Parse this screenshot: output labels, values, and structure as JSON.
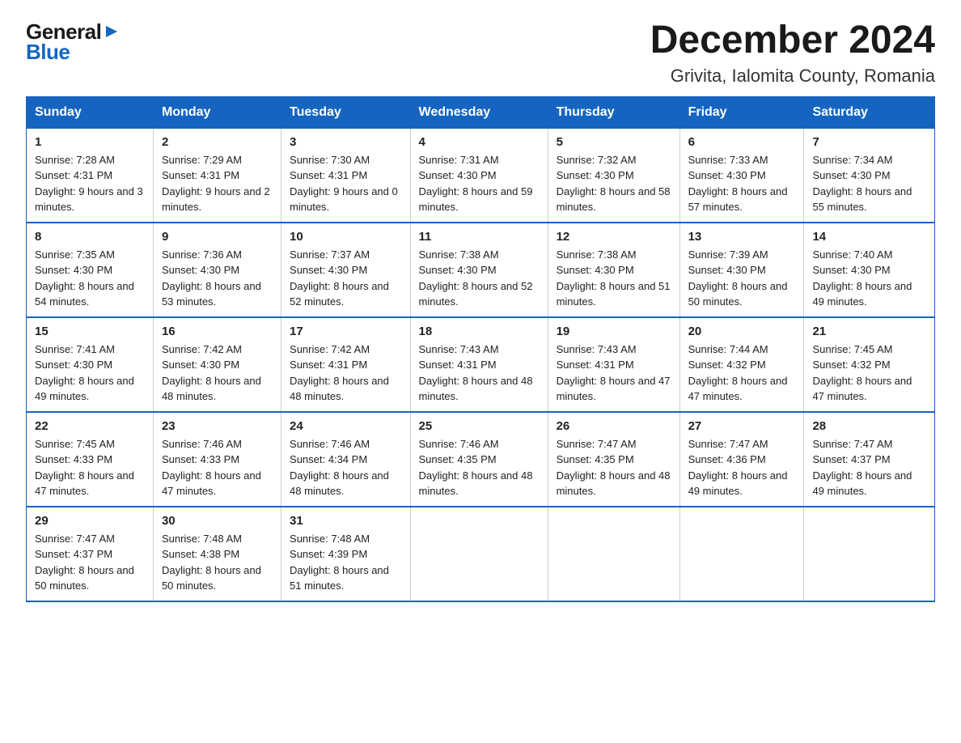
{
  "logo": {
    "general": "General",
    "blue": "Blue",
    "arrow": "▶"
  },
  "title": "December 2024",
  "location": "Grivita, Ialomita County, Romania",
  "days_of_week": [
    "Sunday",
    "Monday",
    "Tuesday",
    "Wednesday",
    "Thursday",
    "Friday",
    "Saturday"
  ],
  "weeks": [
    [
      {
        "day": "1",
        "sunrise": "7:28 AM",
        "sunset": "4:31 PM",
        "daylight": "9 hours and 3 minutes."
      },
      {
        "day": "2",
        "sunrise": "7:29 AM",
        "sunset": "4:31 PM",
        "daylight": "9 hours and 2 minutes."
      },
      {
        "day": "3",
        "sunrise": "7:30 AM",
        "sunset": "4:31 PM",
        "daylight": "9 hours and 0 minutes."
      },
      {
        "day": "4",
        "sunrise": "7:31 AM",
        "sunset": "4:30 PM",
        "daylight": "8 hours and 59 minutes."
      },
      {
        "day": "5",
        "sunrise": "7:32 AM",
        "sunset": "4:30 PM",
        "daylight": "8 hours and 58 minutes."
      },
      {
        "day": "6",
        "sunrise": "7:33 AM",
        "sunset": "4:30 PM",
        "daylight": "8 hours and 57 minutes."
      },
      {
        "day": "7",
        "sunrise": "7:34 AM",
        "sunset": "4:30 PM",
        "daylight": "8 hours and 55 minutes."
      }
    ],
    [
      {
        "day": "8",
        "sunrise": "7:35 AM",
        "sunset": "4:30 PM",
        "daylight": "8 hours and 54 minutes."
      },
      {
        "day": "9",
        "sunrise": "7:36 AM",
        "sunset": "4:30 PM",
        "daylight": "8 hours and 53 minutes."
      },
      {
        "day": "10",
        "sunrise": "7:37 AM",
        "sunset": "4:30 PM",
        "daylight": "8 hours and 52 minutes."
      },
      {
        "day": "11",
        "sunrise": "7:38 AM",
        "sunset": "4:30 PM",
        "daylight": "8 hours and 52 minutes."
      },
      {
        "day": "12",
        "sunrise": "7:38 AM",
        "sunset": "4:30 PM",
        "daylight": "8 hours and 51 minutes."
      },
      {
        "day": "13",
        "sunrise": "7:39 AM",
        "sunset": "4:30 PM",
        "daylight": "8 hours and 50 minutes."
      },
      {
        "day": "14",
        "sunrise": "7:40 AM",
        "sunset": "4:30 PM",
        "daylight": "8 hours and 49 minutes."
      }
    ],
    [
      {
        "day": "15",
        "sunrise": "7:41 AM",
        "sunset": "4:30 PM",
        "daylight": "8 hours and 49 minutes."
      },
      {
        "day": "16",
        "sunrise": "7:42 AM",
        "sunset": "4:30 PM",
        "daylight": "8 hours and 48 minutes."
      },
      {
        "day": "17",
        "sunrise": "7:42 AM",
        "sunset": "4:31 PM",
        "daylight": "8 hours and 48 minutes."
      },
      {
        "day": "18",
        "sunrise": "7:43 AM",
        "sunset": "4:31 PM",
        "daylight": "8 hours and 48 minutes."
      },
      {
        "day": "19",
        "sunrise": "7:43 AM",
        "sunset": "4:31 PM",
        "daylight": "8 hours and 47 minutes."
      },
      {
        "day": "20",
        "sunrise": "7:44 AM",
        "sunset": "4:32 PM",
        "daylight": "8 hours and 47 minutes."
      },
      {
        "day": "21",
        "sunrise": "7:45 AM",
        "sunset": "4:32 PM",
        "daylight": "8 hours and 47 minutes."
      }
    ],
    [
      {
        "day": "22",
        "sunrise": "7:45 AM",
        "sunset": "4:33 PM",
        "daylight": "8 hours and 47 minutes."
      },
      {
        "day": "23",
        "sunrise": "7:46 AM",
        "sunset": "4:33 PM",
        "daylight": "8 hours and 47 minutes."
      },
      {
        "day": "24",
        "sunrise": "7:46 AM",
        "sunset": "4:34 PM",
        "daylight": "8 hours and 48 minutes."
      },
      {
        "day": "25",
        "sunrise": "7:46 AM",
        "sunset": "4:35 PM",
        "daylight": "8 hours and 48 minutes."
      },
      {
        "day": "26",
        "sunrise": "7:47 AM",
        "sunset": "4:35 PM",
        "daylight": "8 hours and 48 minutes."
      },
      {
        "day": "27",
        "sunrise": "7:47 AM",
        "sunset": "4:36 PM",
        "daylight": "8 hours and 49 minutes."
      },
      {
        "day": "28",
        "sunrise": "7:47 AM",
        "sunset": "4:37 PM",
        "daylight": "8 hours and 49 minutes."
      }
    ],
    [
      {
        "day": "29",
        "sunrise": "7:47 AM",
        "sunset": "4:37 PM",
        "daylight": "8 hours and 50 minutes."
      },
      {
        "day": "30",
        "sunrise": "7:48 AM",
        "sunset": "4:38 PM",
        "daylight": "8 hours and 50 minutes."
      },
      {
        "day": "31",
        "sunrise": "7:48 AM",
        "sunset": "4:39 PM",
        "daylight": "8 hours and 51 minutes."
      },
      null,
      null,
      null,
      null
    ]
  ],
  "labels": {
    "sunrise": "Sunrise:",
    "sunset": "Sunset:",
    "daylight": "Daylight:"
  },
  "colors": {
    "header_bg": "#1565c0",
    "header_text": "#ffffff",
    "border": "#1565c0"
  }
}
